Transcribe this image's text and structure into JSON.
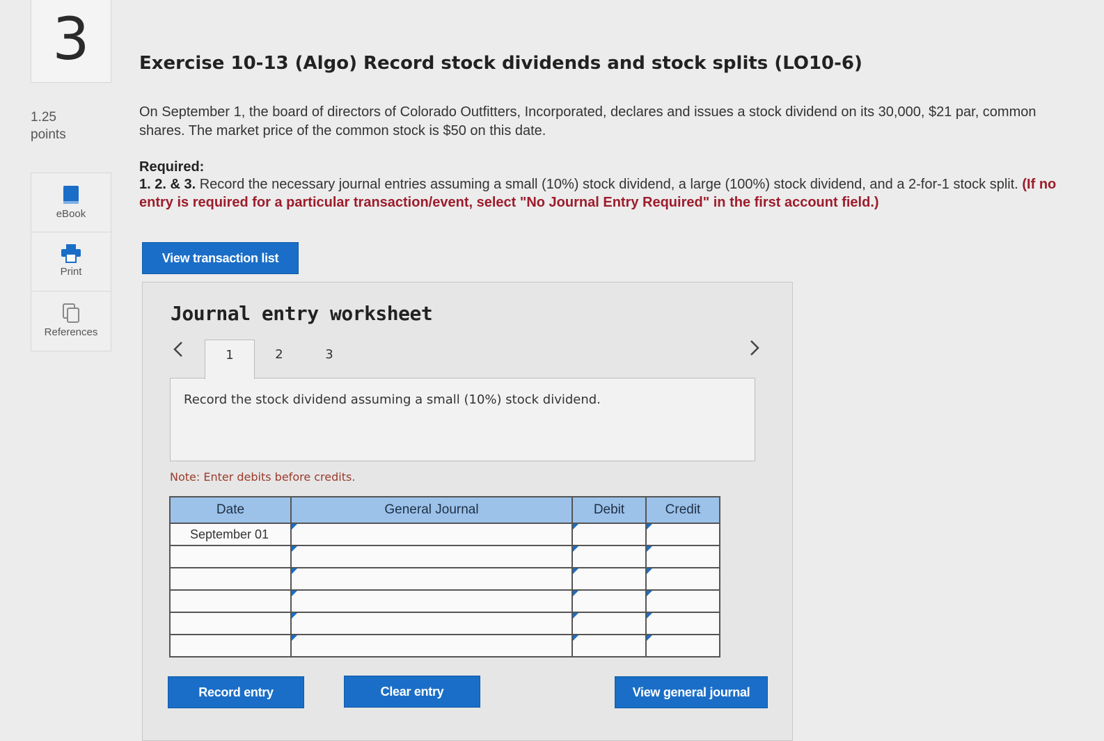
{
  "question": {
    "number": "3",
    "points_value": "1.25",
    "points_label": "points"
  },
  "tools": {
    "ebook": "eBook",
    "print": "Print",
    "references": "References"
  },
  "exercise": {
    "title": "Exercise 10-13 (Algo) Record stock dividends and stock splits (LO10-6)",
    "intro": "On September 1, the board of directors of Colorado Outfitters, Incorporated, declares and issues a stock dividend on its 30,000, $21 par, common shares. The market price of the common stock is $50 on this date.",
    "required_label": "Required:",
    "required_number": "1. 2. & 3.",
    "required_text": " Record the necessary journal entries assuming a small (10%) stock dividend, a large (100%) stock dividend, and a 2-for-1 stock split. ",
    "required_note": "(If no entry is required for a particular transaction/event, select \"No Journal Entry Required\" in the first account field.)"
  },
  "buttons": {
    "view_transaction_list": "View transaction list",
    "record_entry": "Record entry",
    "clear_entry": "Clear entry",
    "view_general_journal": "View general journal"
  },
  "worksheet": {
    "title": "Journal entry worksheet",
    "tabs": [
      "1",
      "2",
      "3"
    ],
    "active_tab": "1",
    "instruction": "Record the stock dividend assuming a small (10%) stock dividend.",
    "note": "Note: Enter debits before credits."
  },
  "journal": {
    "headers": {
      "date": "Date",
      "general_journal": "General Journal",
      "debit": "Debit",
      "credit": "Credit"
    },
    "rows": [
      {
        "date": "September 01",
        "account": "",
        "debit": "",
        "credit": ""
      },
      {
        "date": "",
        "account": "",
        "debit": "",
        "credit": ""
      },
      {
        "date": "",
        "account": "",
        "debit": "",
        "credit": ""
      },
      {
        "date": "",
        "account": "",
        "debit": "",
        "credit": ""
      },
      {
        "date": "",
        "account": "",
        "debit": "",
        "credit": ""
      },
      {
        "date": "",
        "account": "",
        "debit": "",
        "credit": ""
      }
    ]
  },
  "colors": {
    "button_blue": "#1a6ec7",
    "table_header_blue": "#9cc2ea",
    "note_red": "#9c1c2b"
  }
}
